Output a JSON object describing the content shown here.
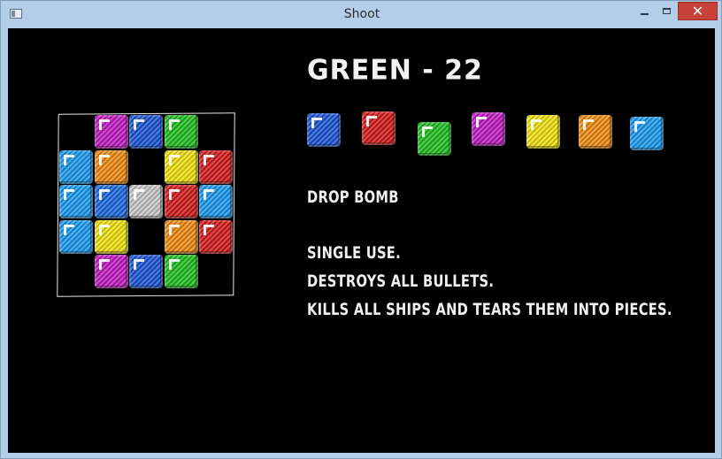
{
  "window": {
    "title": "Shoot",
    "close_label": "✕"
  },
  "game": {
    "heading": "GREEN  -  22",
    "palette": [
      {
        "color": "#1a55d6",
        "name": "blue-block"
      },
      {
        "color": "#d41a1a",
        "name": "red-block"
      },
      {
        "color": "#1fbf1f",
        "name": "green-block"
      },
      {
        "color": "#c21ac2",
        "name": "magenta-block"
      },
      {
        "color": "#f2e20f",
        "name": "yellow-block"
      },
      {
        "color": "#f08a10",
        "name": "orange-block"
      },
      {
        "color": "#1a9af0",
        "name": "light-blue-block"
      }
    ],
    "info": {
      "name": "DROP BOMB",
      "line1": "SINGLE USE.",
      "line2": "DESTROYS ALL BULLETS.",
      "line3": "KILLS ALL SHIPS AND TEARS THEM INTO PIECES."
    },
    "grid": [
      {
        "row": 0,
        "col": 1,
        "color": "#c21ac2"
      },
      {
        "row": 0,
        "col": 2,
        "color": "#1a55d6"
      },
      {
        "row": 0,
        "col": 3,
        "color": "#1fbf1f"
      },
      {
        "row": 1,
        "col": 0,
        "color": "#1a9af0"
      },
      {
        "row": 1,
        "col": 1,
        "color": "#f08a10"
      },
      {
        "row": 1,
        "col": 3,
        "color": "#f2e20f"
      },
      {
        "row": 1,
        "col": 4,
        "color": "#d41a1a"
      },
      {
        "row": 2,
        "col": 0,
        "color": "#1a9af0"
      },
      {
        "row": 2,
        "col": 1,
        "color": "#1a6ae0"
      },
      {
        "row": 2,
        "col": 2,
        "color": "#c8c8c8"
      },
      {
        "row": 2,
        "col": 3,
        "color": "#d41a1a"
      },
      {
        "row": 2,
        "col": 4,
        "color": "#1a9af0"
      },
      {
        "row": 3,
        "col": 0,
        "color": "#1a9af0"
      },
      {
        "row": 3,
        "col": 1,
        "color": "#f2e20f"
      },
      {
        "row": 3,
        "col": 3,
        "color": "#f08a10"
      },
      {
        "row": 3,
        "col": 4,
        "color": "#d41a1a"
      },
      {
        "row": 4,
        "col": 1,
        "color": "#c21ac2"
      },
      {
        "row": 4,
        "col": 2,
        "color": "#1a55d6"
      },
      {
        "row": 4,
        "col": 3,
        "color": "#1fbf1f"
      }
    ]
  }
}
